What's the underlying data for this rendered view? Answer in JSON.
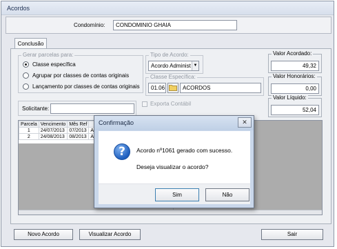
{
  "window": {
    "title": "Acordos"
  },
  "condominio": {
    "label": "Condomínio:",
    "value": "CONDOMINIO GHAIA"
  },
  "tabs": [
    {
      "label": "Conclusão"
    }
  ],
  "gerar_parcelas": {
    "title": "Gerar parcelas para:",
    "options": [
      {
        "label": "Classe específica",
        "selected": true
      },
      {
        "label": "Agrupar por classes de contas originais",
        "selected": false
      },
      {
        "label": "Lançamento por classes de contas originais",
        "selected": false
      }
    ]
  },
  "tipo_acordo": {
    "title": "Tipo de Acordo:",
    "value": "Acordo Administ"
  },
  "classe_especifica": {
    "title": "Classe Específica:",
    "code": "01.06",
    "name": "ACORDOS"
  },
  "exporta_contabil": {
    "label": "Exporta Contábil",
    "checked": false
  },
  "valores": {
    "acordado": {
      "label": "Valor Acordado:",
      "value": "49,32"
    },
    "honorarios": {
      "label": "Valor Honorários:",
      "value": "0,00"
    },
    "liquido": {
      "label": "Valor Líquido:",
      "value": "52,04"
    }
  },
  "solicitante": {
    "label": "Solicitante:",
    "value": ""
  },
  "parcelas_table": {
    "headers": [
      "Parcela",
      "Vencimento",
      "Mês Ref",
      ""
    ],
    "rows": [
      [
        "1",
        "24/07/2013",
        "07/2013",
        "A"
      ],
      [
        "2",
        "24/08/2013",
        "08/2013",
        "A"
      ]
    ]
  },
  "buttons": {
    "novo_acordo": "Novo Acordo",
    "visualizar_acordo": "Visualizar Acordo",
    "sair": "Sair"
  },
  "dialog": {
    "title": "Confirmação",
    "close": "✕",
    "message": "Acordo nº1061 gerado com sucesso.",
    "question": "Deseja visualizar o acordo?",
    "yes": "Sim",
    "no": "Não",
    "icon": "question-icon"
  }
}
